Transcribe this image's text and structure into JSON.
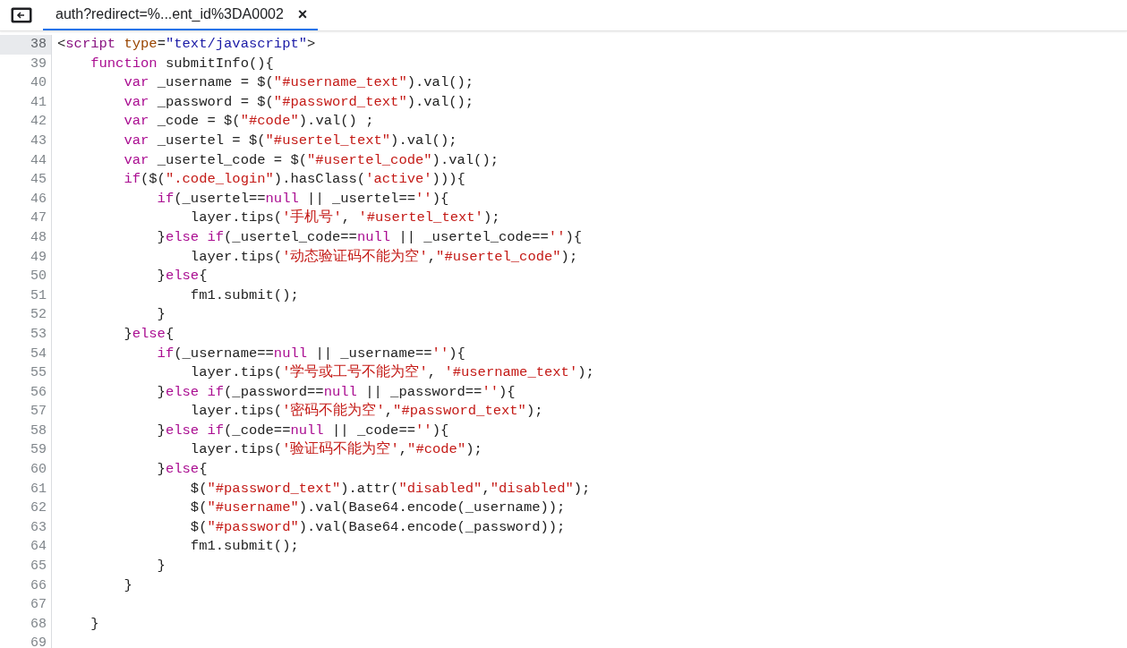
{
  "tabs": [
    {
      "label": "auth?redirect=%...ent_id%3DA0002",
      "selected": true,
      "close": "×"
    }
  ],
  "lines": [
    {
      "number": "38",
      "selected": true,
      "tokens": [
        {
          "kind": "p",
          "text": "<"
        },
        {
          "kind": "tag",
          "text": "script"
        },
        {
          "kind": "attr",
          "text": " type"
        },
        {
          "kind": "p",
          "text": "="
        },
        {
          "kind": "av",
          "text": "\"text/javascript\""
        },
        {
          "kind": "p",
          "text": ">"
        }
      ]
    },
    {
      "number": "39",
      "selected": false,
      "tokens": [
        {
          "kind": "kw",
          "text": "    function"
        },
        {
          "kind": "p",
          "text": " submitInfo(){"
        }
      ]
    },
    {
      "number": "40",
      "selected": false,
      "tokens": [
        {
          "kind": "kw",
          "text": "        var"
        },
        {
          "kind": "p",
          "text": " _username = $("
        },
        {
          "kind": "s",
          "text": "\"#username_text\""
        },
        {
          "kind": "p",
          "text": ").val();"
        }
      ]
    },
    {
      "number": "41",
      "selected": false,
      "tokens": [
        {
          "kind": "kw",
          "text": "        var"
        },
        {
          "kind": "p",
          "text": " _password = $("
        },
        {
          "kind": "s",
          "text": "\"#password_text\""
        },
        {
          "kind": "p",
          "text": ").val();"
        }
      ]
    },
    {
      "number": "42",
      "selected": false,
      "tokens": [
        {
          "kind": "kw",
          "text": "        var"
        },
        {
          "kind": "p",
          "text": " _code = $("
        },
        {
          "kind": "s",
          "text": "\"#code\""
        },
        {
          "kind": "p",
          "text": ").val() ;"
        }
      ]
    },
    {
      "number": "43",
      "selected": false,
      "tokens": [
        {
          "kind": "kw",
          "text": "        var"
        },
        {
          "kind": "p",
          "text": " _usertel = $("
        },
        {
          "kind": "s",
          "text": "\"#usertel_text\""
        },
        {
          "kind": "p",
          "text": ").val();"
        }
      ]
    },
    {
      "number": "44",
      "selected": false,
      "tokens": [
        {
          "kind": "kw",
          "text": "        var"
        },
        {
          "kind": "p",
          "text": " _usertel_code = $("
        },
        {
          "kind": "s",
          "text": "\"#usertel_code\""
        },
        {
          "kind": "p",
          "text": ").val();"
        }
      ]
    },
    {
      "number": "45",
      "selected": false,
      "tokens": [
        {
          "kind": "kw",
          "text": "        if"
        },
        {
          "kind": "p",
          "text": "($("
        },
        {
          "kind": "s",
          "text": "\".code_login\""
        },
        {
          "kind": "p",
          "text": ").hasClass("
        },
        {
          "kind": "s",
          "text": "'active'"
        },
        {
          "kind": "p",
          "text": "))){"
        }
      ]
    },
    {
      "number": "46",
      "selected": false,
      "tokens": [
        {
          "kind": "kw",
          "text": "            if"
        },
        {
          "kind": "p",
          "text": "(_usertel=="
        },
        {
          "kind": "kw",
          "text": "null"
        },
        {
          "kind": "p",
          "text": " || _usertel=="
        },
        {
          "kind": "s",
          "text": "''"
        },
        {
          "kind": "p",
          "text": "){"
        }
      ]
    },
    {
      "number": "47",
      "selected": false,
      "tokens": [
        {
          "kind": "p",
          "text": "                layer.tips("
        },
        {
          "kind": "s",
          "text": "'手机号'"
        },
        {
          "kind": "p",
          "text": ", "
        },
        {
          "kind": "s",
          "text": "'#usertel_text'"
        },
        {
          "kind": "p",
          "text": ");"
        }
      ]
    },
    {
      "number": "48",
      "selected": false,
      "tokens": [
        {
          "kind": "p",
          "text": "            }"
        },
        {
          "kind": "kw",
          "text": "else if"
        },
        {
          "kind": "p",
          "text": "(_usertel_code=="
        },
        {
          "kind": "kw",
          "text": "null"
        },
        {
          "kind": "p",
          "text": " || _usertel_code=="
        },
        {
          "kind": "s",
          "text": "''"
        },
        {
          "kind": "p",
          "text": "){"
        }
      ]
    },
    {
      "number": "49",
      "selected": false,
      "tokens": [
        {
          "kind": "p",
          "text": "                layer.tips("
        },
        {
          "kind": "s",
          "text": "'动态验证码不能为空'"
        },
        {
          "kind": "p",
          "text": ","
        },
        {
          "kind": "s",
          "text": "\"#usertel_code\""
        },
        {
          "kind": "p",
          "text": ");"
        }
      ]
    },
    {
      "number": "50",
      "selected": false,
      "tokens": [
        {
          "kind": "p",
          "text": "            }"
        },
        {
          "kind": "kw",
          "text": "else"
        },
        {
          "kind": "p",
          "text": "{"
        }
      ]
    },
    {
      "number": "51",
      "selected": false,
      "tokens": [
        {
          "kind": "p",
          "text": "                fm1.submit();"
        }
      ]
    },
    {
      "number": "52",
      "selected": false,
      "tokens": [
        {
          "kind": "p",
          "text": "            }"
        }
      ]
    },
    {
      "number": "53",
      "selected": false,
      "tokens": [
        {
          "kind": "p",
          "text": "        }"
        },
        {
          "kind": "kw",
          "text": "else"
        },
        {
          "kind": "p",
          "text": "{"
        }
      ]
    },
    {
      "number": "54",
      "selected": false,
      "tokens": [
        {
          "kind": "kw",
          "text": "            if"
        },
        {
          "kind": "p",
          "text": "(_username=="
        },
        {
          "kind": "kw",
          "text": "null"
        },
        {
          "kind": "p",
          "text": " || _username=="
        },
        {
          "kind": "s",
          "text": "''"
        },
        {
          "kind": "p",
          "text": "){"
        }
      ]
    },
    {
      "number": "55",
      "selected": false,
      "tokens": [
        {
          "kind": "p",
          "text": "                layer.tips("
        },
        {
          "kind": "s",
          "text": "'学号或工号不能为空'"
        },
        {
          "kind": "p",
          "text": ", "
        },
        {
          "kind": "s",
          "text": "'#username_text'"
        },
        {
          "kind": "p",
          "text": ");"
        }
      ]
    },
    {
      "number": "56",
      "selected": false,
      "tokens": [
        {
          "kind": "p",
          "text": "            }"
        },
        {
          "kind": "kw",
          "text": "else if"
        },
        {
          "kind": "p",
          "text": "(_password=="
        },
        {
          "kind": "kw",
          "text": "null"
        },
        {
          "kind": "p",
          "text": " || _password=="
        },
        {
          "kind": "s",
          "text": "''"
        },
        {
          "kind": "p",
          "text": "){"
        }
      ]
    },
    {
      "number": "57",
      "selected": false,
      "tokens": [
        {
          "kind": "p",
          "text": "                layer.tips("
        },
        {
          "kind": "s",
          "text": "'密码不能为空'"
        },
        {
          "kind": "p",
          "text": ","
        },
        {
          "kind": "s",
          "text": "\"#password_text\""
        },
        {
          "kind": "p",
          "text": ");"
        }
      ]
    },
    {
      "number": "58",
      "selected": false,
      "tokens": [
        {
          "kind": "p",
          "text": "            }"
        },
        {
          "kind": "kw",
          "text": "else if"
        },
        {
          "kind": "p",
          "text": "(_code=="
        },
        {
          "kind": "kw",
          "text": "null"
        },
        {
          "kind": "p",
          "text": " || _code=="
        },
        {
          "kind": "s",
          "text": "''"
        },
        {
          "kind": "p",
          "text": "){"
        }
      ]
    },
    {
      "number": "59",
      "selected": false,
      "tokens": [
        {
          "kind": "p",
          "text": "                layer.tips("
        },
        {
          "kind": "s",
          "text": "'验证码不能为空'"
        },
        {
          "kind": "p",
          "text": ","
        },
        {
          "kind": "s",
          "text": "\"#code\""
        },
        {
          "kind": "p",
          "text": ");"
        }
      ]
    },
    {
      "number": "60",
      "selected": false,
      "tokens": [
        {
          "kind": "p",
          "text": "            }"
        },
        {
          "kind": "kw",
          "text": "else"
        },
        {
          "kind": "p",
          "text": "{"
        }
      ]
    },
    {
      "number": "61",
      "selected": false,
      "tokens": [
        {
          "kind": "p",
          "text": "                $("
        },
        {
          "kind": "s",
          "text": "\"#password_text\""
        },
        {
          "kind": "p",
          "text": ").attr("
        },
        {
          "kind": "s",
          "text": "\"disabled\""
        },
        {
          "kind": "p",
          "text": ","
        },
        {
          "kind": "s",
          "text": "\"disabled\""
        },
        {
          "kind": "p",
          "text": ");"
        }
      ]
    },
    {
      "number": "62",
      "selected": false,
      "tokens": [
        {
          "kind": "p",
          "text": "                $("
        },
        {
          "kind": "s",
          "text": "\"#username\""
        },
        {
          "kind": "p",
          "text": ").val(Base64.encode(_username));"
        }
      ]
    },
    {
      "number": "63",
      "selected": false,
      "tokens": [
        {
          "kind": "p",
          "text": "                $("
        },
        {
          "kind": "s",
          "text": "\"#password\""
        },
        {
          "kind": "p",
          "text": ").val(Base64.encode(_password));"
        }
      ]
    },
    {
      "number": "64",
      "selected": false,
      "tokens": [
        {
          "kind": "p",
          "text": "                fm1.submit();"
        }
      ]
    },
    {
      "number": "65",
      "selected": false,
      "tokens": [
        {
          "kind": "p",
          "text": "            }"
        }
      ]
    },
    {
      "number": "66",
      "selected": false,
      "tokens": [
        {
          "kind": "p",
          "text": "        }"
        }
      ]
    },
    {
      "number": "67",
      "selected": false
    },
    {
      "number": "68",
      "selected": false,
      "tokens": [
        {
          "kind": "p",
          "text": "    }"
        }
      ]
    },
    {
      "number": "69",
      "selected": false
    }
  ]
}
